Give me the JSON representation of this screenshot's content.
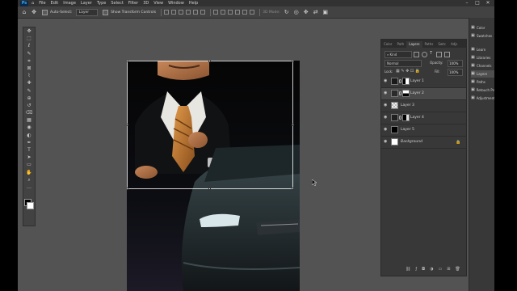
{
  "menubar": {
    "logo": "Ps",
    "items": [
      "File",
      "Edit",
      "Image",
      "Layer",
      "Type",
      "Select",
      "Filter",
      "3D",
      "View",
      "Window",
      "Help"
    ],
    "window_controls": [
      "–",
      "□",
      "✕"
    ]
  },
  "options": {
    "auto_select_label": "Auto-Select:",
    "auto_select_value": "Layer",
    "transform_label": "Show Transform Controls",
    "mode_label": "3D Mode:"
  },
  "toolbar": {
    "tools": [
      "move-icon",
      "marquee-icon",
      "lasso-icon",
      "quick-select-icon",
      "crop-icon",
      "frame-icon",
      "eyedropper-icon",
      "healing-icon",
      "brush-icon",
      "stamp-icon",
      "history-brush-icon",
      "eraser-icon",
      "gradient-icon",
      "blur-icon",
      "dodge-icon",
      "pen-icon",
      "type-icon",
      "path-select-icon",
      "shape-icon",
      "hand-icon",
      "zoom-icon",
      "more-icon"
    ],
    "glyphs": [
      "✥",
      "⬚",
      "ℓ",
      "✎",
      "⌗",
      "⊠",
      "⌇",
      "✚",
      "✎",
      "⊕",
      "↺",
      "⌫",
      "▦",
      "◉",
      "◐",
      "✒",
      "T",
      "➤",
      "▭",
      "✋",
      "⌕",
      "…"
    ]
  },
  "layers_panel": {
    "tabs": [
      "Color",
      "Path",
      "Layers",
      "Paths",
      "Swtc",
      "Adjs"
    ],
    "active_tab": "Layers",
    "filter": "Kind",
    "blend_mode": "Normal",
    "opacity_label": "Opacity:",
    "opacity_value": "100%",
    "lock_label": "Lock:",
    "fill_label": "Fill:",
    "fill_value": "100%",
    "layers": [
      {
        "name": "Layer 1",
        "selected": false
      },
      {
        "name": "Layer 2",
        "selected": true
      },
      {
        "name": "Layer 3",
        "selected": false
      },
      {
        "name": "Layer 4",
        "selected": false
      },
      {
        "name": "Layer 5",
        "selected": false
      },
      {
        "name": "Background",
        "selected": false
      }
    ]
  },
  "right_panel": {
    "items": [
      {
        "icon": "color-icon",
        "label": "Color"
      },
      {
        "icon": "swatches-icon",
        "label": "Swatches"
      },
      {
        "icon": "learn-icon",
        "label": "Learn"
      },
      {
        "icon": "libraries-icon",
        "label": "Libraries"
      },
      {
        "icon": "channels-icon",
        "label": "Channels"
      },
      {
        "icon": "layers-icon",
        "label": "Layers"
      },
      {
        "icon": "paths-icon",
        "label": "Paths"
      },
      {
        "icon": "retouch-icon",
        "label": "Retouch Pro"
      },
      {
        "icon": "adjustments-icon",
        "label": "Adjustments"
      }
    ]
  }
}
